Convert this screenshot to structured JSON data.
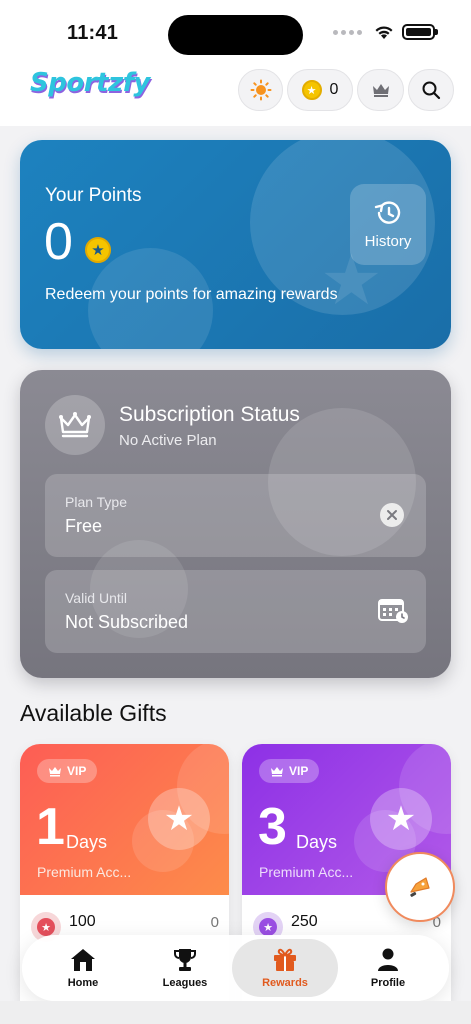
{
  "status_bar": {
    "time": "11:41"
  },
  "header": {
    "logo": "Sportzfy",
    "points_value": "0"
  },
  "points_card": {
    "title": "Your Points",
    "value": "0",
    "subtitle": "Redeem your points for amazing rewards",
    "history_label": "History"
  },
  "subscription": {
    "title": "Subscription Status",
    "subtitle": "No Active Plan",
    "plan_type_label": "Plan Type",
    "plan_type_value": "Free",
    "valid_until_label": "Valid Until",
    "valid_until_value": "Not Subscribed"
  },
  "gifts": {
    "section_title": "Available Gifts",
    "items": [
      {
        "badge": "VIP",
        "number": "1",
        "unit": "Days",
        "description": "Premium Acc...",
        "cost": "100",
        "right": "0",
        "color": "#fd6a52"
      },
      {
        "badge": "VIP",
        "number": "3",
        "unit": "Days",
        "description": "Premium Acc...",
        "cost": "250",
        "right": "0",
        "color": "#9b3de6"
      }
    ]
  },
  "tabbar": {
    "items": [
      {
        "label": "Home",
        "icon": "home-icon"
      },
      {
        "label": "Leagues",
        "icon": "trophy-icon"
      },
      {
        "label": "Rewards",
        "icon": "gift-icon",
        "active": true
      },
      {
        "label": "Profile",
        "icon": "person-icon"
      }
    ]
  },
  "colors": {
    "points_card": "#1d7bb8",
    "subscription_card": "#83828b",
    "accent_active_tab": "#e15a1e",
    "coin": "#f5c400"
  }
}
